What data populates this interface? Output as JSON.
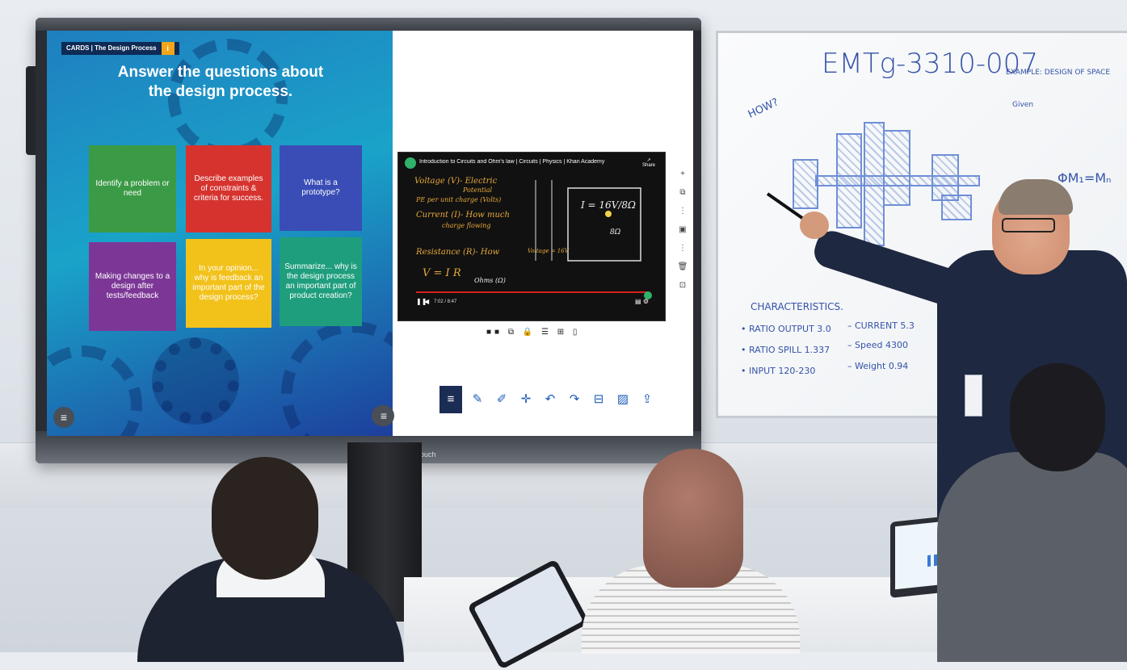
{
  "display": {
    "brand": "ClearTouch",
    "left_pane": {
      "tag": "CARDS | The Design Process",
      "tag_badge": "i",
      "title_line1": "Answer the questions about",
      "title_line2": "the design process.",
      "cards": [
        {
          "text": "Identify a problem or need",
          "color": "#3b9a46"
        },
        {
          "text": "Describe examples of constraints & criteria for success.",
          "color": "#d6332f"
        },
        {
          "text": "What is a prototype?",
          "color": "#3a4db6"
        },
        {
          "text": "Making changes to a design after tests/feedback",
          "color": "#7c3796"
        },
        {
          "text": "In your opinion... why is feedback an important part of the design process?",
          "color": "#f2c21b"
        },
        {
          "text": "Summarize... why is the design process an important part of product creation?",
          "color": "#1f9e7d"
        }
      ]
    },
    "right_pane": {
      "video_title": "Introduction to Circuits and Ohm's law | Circuits | Physics | Khan Academy",
      "share": "Share",
      "time": "7:02 / 8:47",
      "handwriting": {
        "voltage": "Voltage (V)- Electric",
        "potential": "Potential",
        "pe": "PE per unit charge (Volts)",
        "current": "Current (I)- How much",
        "current2": "charge flowing",
        "resistance": "Resistance (R)- How",
        "ohm": "V = I R",
        "ohms": "Ohms (Ω)",
        "formula": "I = 16V/8Ω",
        "r_val": "8Ω",
        "voltage_val": "Voltage = 16V"
      }
    }
  },
  "whiteboard": {
    "code": "EMTg-3310-007",
    "example": "EXAMPLE: DESIGN OF SPACE",
    "given": "Given",
    "phi": "ΦM₁=Mₙ",
    "how": "HOW?",
    "characteristics": "CHARACTERISTICS.",
    "rows": [
      {
        "left": "• RATIO OUTPUT 3.0",
        "right": "– CURRENT 5.3"
      },
      {
        "left": "• RATIO SPILL 1.337",
        "right": "– Speed 4300"
      },
      {
        "left": "• INPUT 120-230",
        "right": "– Weight 0.94"
      }
    ]
  },
  "colors": {
    "screen_gradient_a": "#1f7fc0",
    "screen_gradient_b": "#1d3f9c",
    "marker_blue": "#3553a8",
    "video_red": "#d62020"
  },
  "icons": [
    "menu-icon",
    "pen-icon",
    "highlighter-icon",
    "move-icon",
    "undo-icon",
    "redo-icon",
    "screenshot-icon",
    "image-icon",
    "export-icon",
    "plus-icon",
    "trash-icon"
  ]
}
